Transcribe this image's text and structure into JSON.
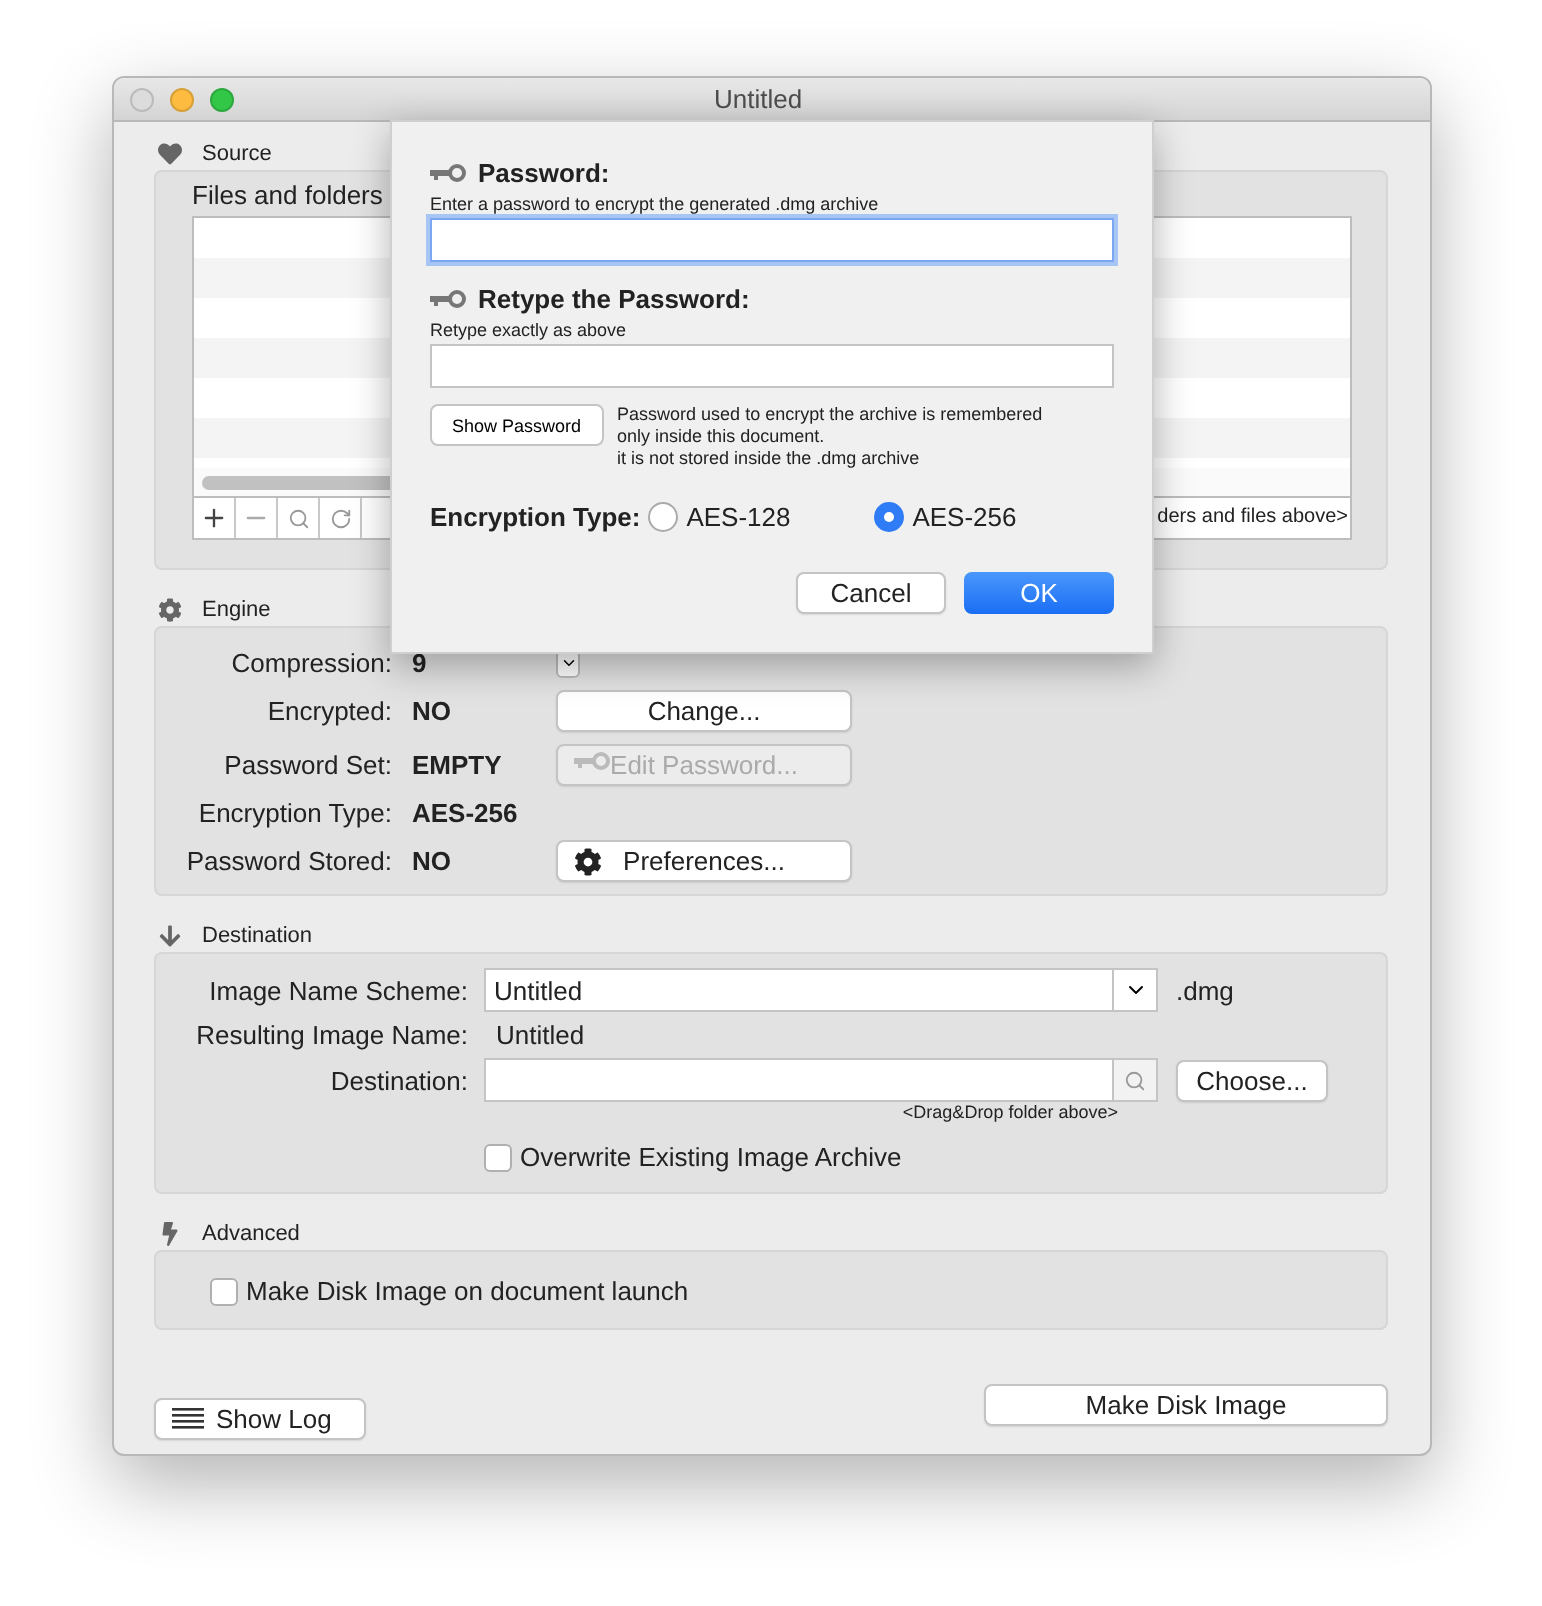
{
  "window": {
    "title": "Untitled"
  },
  "source": {
    "label": "Source",
    "files_label": "Files and folders",
    "drop_hint": "ders and files above>"
  },
  "engine": {
    "label": "Engine",
    "rows": [
      {
        "label": "Compression:",
        "value": "9",
        "kind": "popup"
      },
      {
        "label": "Encrypted:",
        "value": "NO",
        "kind": "button",
        "button": {
          "label": "Change...",
          "disabled": false
        }
      },
      {
        "label": "Password Set:",
        "value": "EMPTY",
        "kind": "key-button",
        "button": {
          "label": "Edit Password...",
          "disabled": true
        }
      },
      {
        "label": "Encryption Type:",
        "value": "AES-256",
        "kind": "plain"
      },
      {
        "label": "Password  Stored:",
        "value": "NO",
        "kind": "gear-button",
        "button": {
          "label": "Preferences...",
          "disabled": false
        }
      }
    ]
  },
  "destination": {
    "label": "Destination",
    "scheme_label": "Image Name Scheme:",
    "scheme_value": "Untitled",
    "extension": ".dmg",
    "result_label": "Resulting Image Name:",
    "result_value": "Untitled",
    "dest_label": "Destination:",
    "dest_hint": "<Drag&Drop folder above>",
    "choose": "Choose...",
    "overwrite": {
      "label": "Overwrite Existing Image Archive",
      "checked": false
    }
  },
  "advanced": {
    "label": "Advanced",
    "launch": {
      "label": "Make Disk Image on document launch",
      "checked": false
    }
  },
  "footer": {
    "show_log": "Show Log",
    "make": "Make Disk Image"
  },
  "sheet": {
    "password_title": "Password:",
    "password_hint": "Enter a password to encrypt the generated .dmg archive",
    "retype_title": "Retype the Password:",
    "retype_hint": "Retype exactly as above",
    "show_password": "Show Password",
    "note": [
      "Password used to encrypt the archive is remembered",
      "only inside this document.",
      "it is not stored inside the .dmg archive"
    ],
    "enc_label": "Encryption Type:",
    "options": [
      {
        "label": "AES-128",
        "selected": false
      },
      {
        "label": "AES-256",
        "selected": true
      }
    ],
    "cancel": "Cancel",
    "ok": "OK"
  }
}
